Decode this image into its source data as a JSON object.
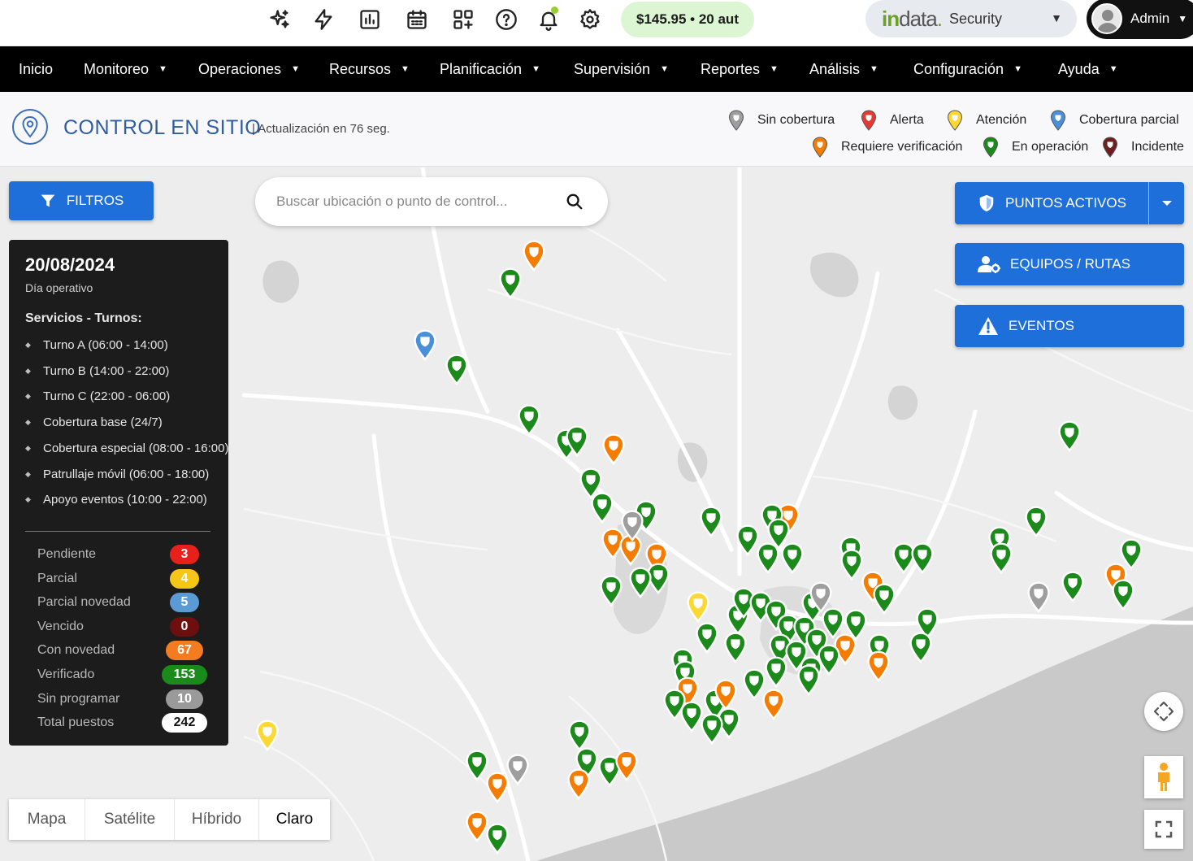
{
  "topbar": {
    "icons": [
      "sparkles-icon",
      "bolt-icon",
      "report-chart-icon",
      "calendar-icon",
      "qr-code-icon",
      "help-icon",
      "bell-icon",
      "settings-icon"
    ],
    "balance": "$145.95 • 20 aut",
    "brand": {
      "logo_in": "in",
      "logo_data": "data",
      "logo_dot": ".",
      "product": "Security"
    },
    "user": {
      "name": "Admin"
    }
  },
  "nav": {
    "items": [
      {
        "label": "Inicio",
        "has_menu": false
      },
      {
        "label": "Monitoreo",
        "has_menu": true
      },
      {
        "label": "Operaciones",
        "has_menu": true
      },
      {
        "label": "Recursos",
        "has_menu": true
      },
      {
        "label": "Planificación",
        "has_menu": true
      },
      {
        "label": "Supervisión",
        "has_menu": true
      },
      {
        "label": "Reportes",
        "has_menu": true
      },
      {
        "label": "Análisis",
        "has_menu": true
      },
      {
        "label": "Configuración",
        "has_menu": true
      },
      {
        "label": "Ayuda",
        "has_menu": true
      }
    ]
  },
  "header": {
    "title": "CONTROL EN SITIO",
    "update_text": "| Actualización en 76 seg."
  },
  "legend": [
    {
      "label": "Sin cobertura",
      "color": "#9e9e9e"
    },
    {
      "label": "Alerta",
      "color": "#e53935"
    },
    {
      "label": "Atención",
      "color": "#fdd835"
    },
    {
      "label": "Cobertura parcial",
      "color": "#4a90d9"
    },
    {
      "label": "Requiere verificación",
      "color": "#f57c00"
    },
    {
      "label": "En operación",
      "color": "#1b8a1b"
    },
    {
      "label": "Incidente",
      "color": "#6d1f1f"
    }
  ],
  "map_controls": {
    "filters_label": "FILTROS",
    "search_placeholder": "Buscar ubicación o punto de control...",
    "active_points_label": "PUNTOS ACTIVOS",
    "teams_label": "EQUIPOS / RUTAS",
    "events_label": "EVENTOS",
    "map_types": [
      "Mapa",
      "Satélite",
      "Híbrido",
      "Claro"
    ],
    "active_map_type": "Claro"
  },
  "panel": {
    "date": "20/08/2024",
    "subtitle": "Día operativo",
    "section_title": "Servicios - Turnos:",
    "shifts": [
      "Turno A (06:00 - 14:00)",
      "Turno B (14:00 - 22:00)",
      "Turno C (22:00 - 06:00)",
      "Cobertura base (24/7)",
      "Cobertura especial (08:00 - 16:00)",
      "Patrullaje móvil (06:00 - 18:00)",
      "Apoyo eventos (10:00 - 22:00)"
    ],
    "stats": [
      {
        "label": "Pendiente",
        "value": "3",
        "color": "#e8201c",
        "text": "#ffffff"
      },
      {
        "label": "Parcial",
        "value": "4",
        "color": "#f5c518",
        "text": "#ffffff"
      },
      {
        "label": "Parcial novedad",
        "value": "5",
        "color": "#5b9bd5",
        "text": "#ffffff"
      },
      {
        "label": "Vencido",
        "value": "0",
        "color": "#6e0f0f",
        "text": "#ffffff"
      },
      {
        "label": "Con novedad",
        "value": "67",
        "color": "#f47c20",
        "text": "#ffffff"
      },
      {
        "label": "Verificado",
        "value": "153",
        "color": "#1a8a1a",
        "text": "#ffffff"
      },
      {
        "label": "Sin programar",
        "value": "10",
        "color": "#9a9a9a",
        "text": "#ffffff"
      },
      {
        "label": "Total puestos",
        "value": "242",
        "color": "#ffffff",
        "text": "#111111"
      }
    ]
  },
  "markers": [
    {
      "status": "requiere",
      "color": "#f57c00"
    },
    {
      "status": "operacion",
      "color": "#1b8a1b"
    },
    {
      "status": "cobertura_parcial",
      "color": "#4a90d9"
    },
    {
      "status": "atencion",
      "color": "#fdd835"
    },
    {
      "status": "sin_cobertura",
      "color": "#9e9e9e"
    }
  ]
}
